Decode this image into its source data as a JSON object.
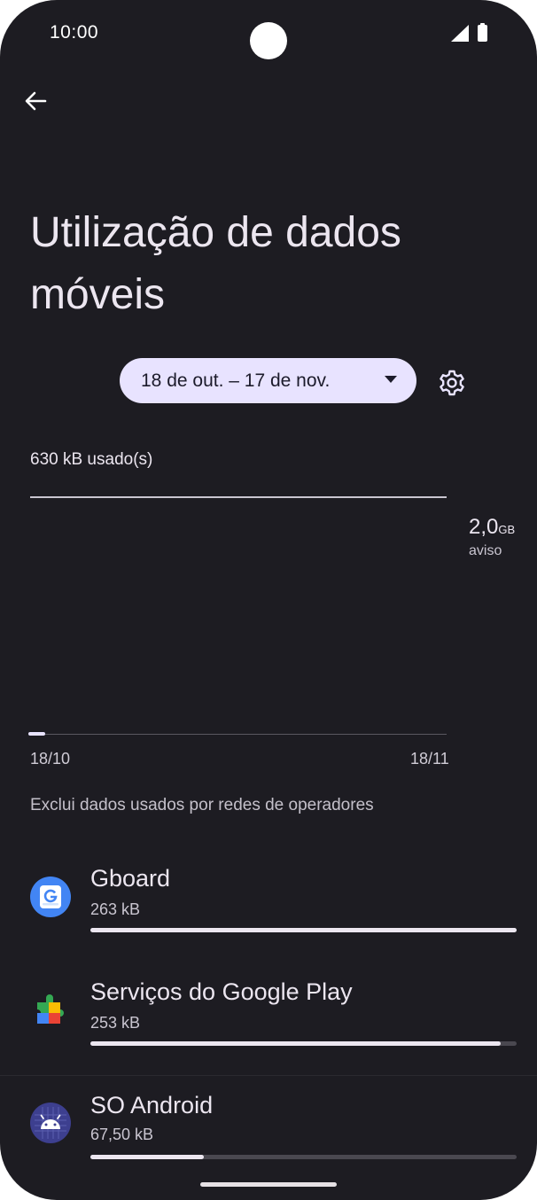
{
  "status_bar": {
    "time": "10:00"
  },
  "header": {
    "title": "Utilização de dados móveis"
  },
  "cycle": {
    "label": "18 de out. – 17 de nov."
  },
  "summary": {
    "used": "630 kB usado(s)",
    "warning_value": "2,0",
    "warning_unit": "GB",
    "warning_label": "aviso",
    "usage_fraction": 0.0003
  },
  "chart": {
    "x_start": "18/10",
    "x_end": "18/11"
  },
  "note": "Exclui dados usados por redes de operadores",
  "apps": [
    {
      "name": "Gboard",
      "size": "263 kB",
      "fraction": 1.0,
      "icon": "gboard-icon"
    },
    {
      "name": "Serviços do Google Play",
      "size": "253 kB",
      "fraction": 0.962,
      "icon": "google-play-services-icon"
    },
    {
      "name": "SO Android",
      "size": "67,50 kB",
      "fraction": 0.267,
      "icon": "android-os-icon"
    }
  ],
  "colors": {
    "background": "#1d1c22",
    "accent": "#e8e3ff",
    "text": "#ece6f0"
  }
}
